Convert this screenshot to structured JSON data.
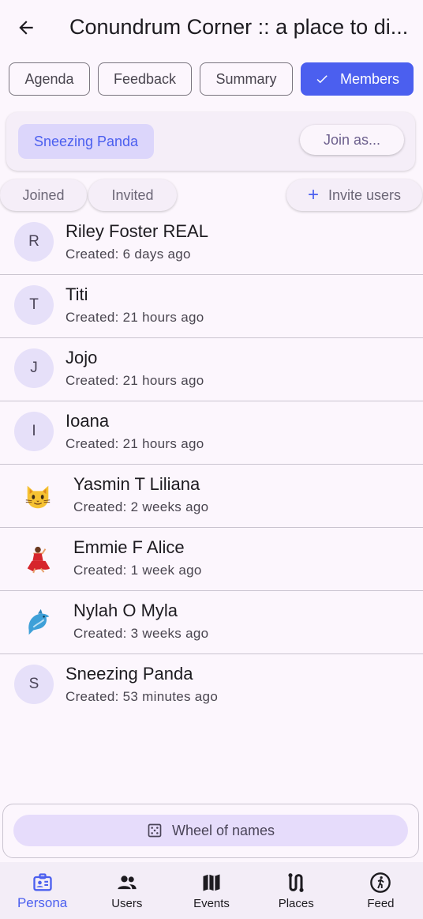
{
  "header": {
    "title": "Conundrum Corner :: a place to di..."
  },
  "tabs": [
    {
      "label": "Agenda",
      "active": false
    },
    {
      "label": "Feedback",
      "active": false
    },
    {
      "label": "Summary",
      "active": false
    },
    {
      "label": "Members",
      "active": true
    }
  ],
  "persona": {
    "name": "Sneezing Panda",
    "join_label": "Join as..."
  },
  "filters": {
    "joined": "Joined",
    "invited": "Invited",
    "invite_users": "Invite users"
  },
  "members": [
    {
      "initial": "R",
      "emoji": "",
      "name": "Riley Foster REAL",
      "created": "Created: 6 days ago"
    },
    {
      "initial": "T",
      "emoji": "",
      "name": "Titi",
      "created": "Created: 21 hours ago"
    },
    {
      "initial": "J",
      "emoji": "",
      "name": "Jojo",
      "created": "Created: 21 hours ago"
    },
    {
      "initial": "I",
      "emoji": "",
      "name": "Ioana",
      "created": "Created: 21 hours ago"
    },
    {
      "initial": "",
      "emoji": "cat-face",
      "name": "Yasmin T Liliana",
      "created": "Created: 2 weeks ago"
    },
    {
      "initial": "",
      "emoji": "dancer",
      "name": "Emmie F Alice",
      "created": "Created: 1 week ago"
    },
    {
      "initial": "",
      "emoji": "dolphin",
      "name": "Nylah O Myla",
      "created": "Created: 3 weeks ago"
    },
    {
      "initial": "S",
      "emoji": "",
      "name": "Sneezing Panda",
      "created": "Created: 53 minutes ago"
    }
  ],
  "wheel": {
    "label": "Wheel of names"
  },
  "nav": [
    {
      "label": "Persona",
      "icon": "persona-icon",
      "active": true
    },
    {
      "label": "Users",
      "icon": "users-icon",
      "active": false
    },
    {
      "label": "Events",
      "icon": "map-icon",
      "active": false
    },
    {
      "label": "Places",
      "icon": "route-icon",
      "active": false
    },
    {
      "label": "Feed",
      "icon": "runner-icon",
      "active": false
    }
  ],
  "colors": {
    "accent": "#4b5fef",
    "chip": "#dcd6fb",
    "avatar_bg": "#e6e0f9",
    "background": "#fcf6fd"
  }
}
